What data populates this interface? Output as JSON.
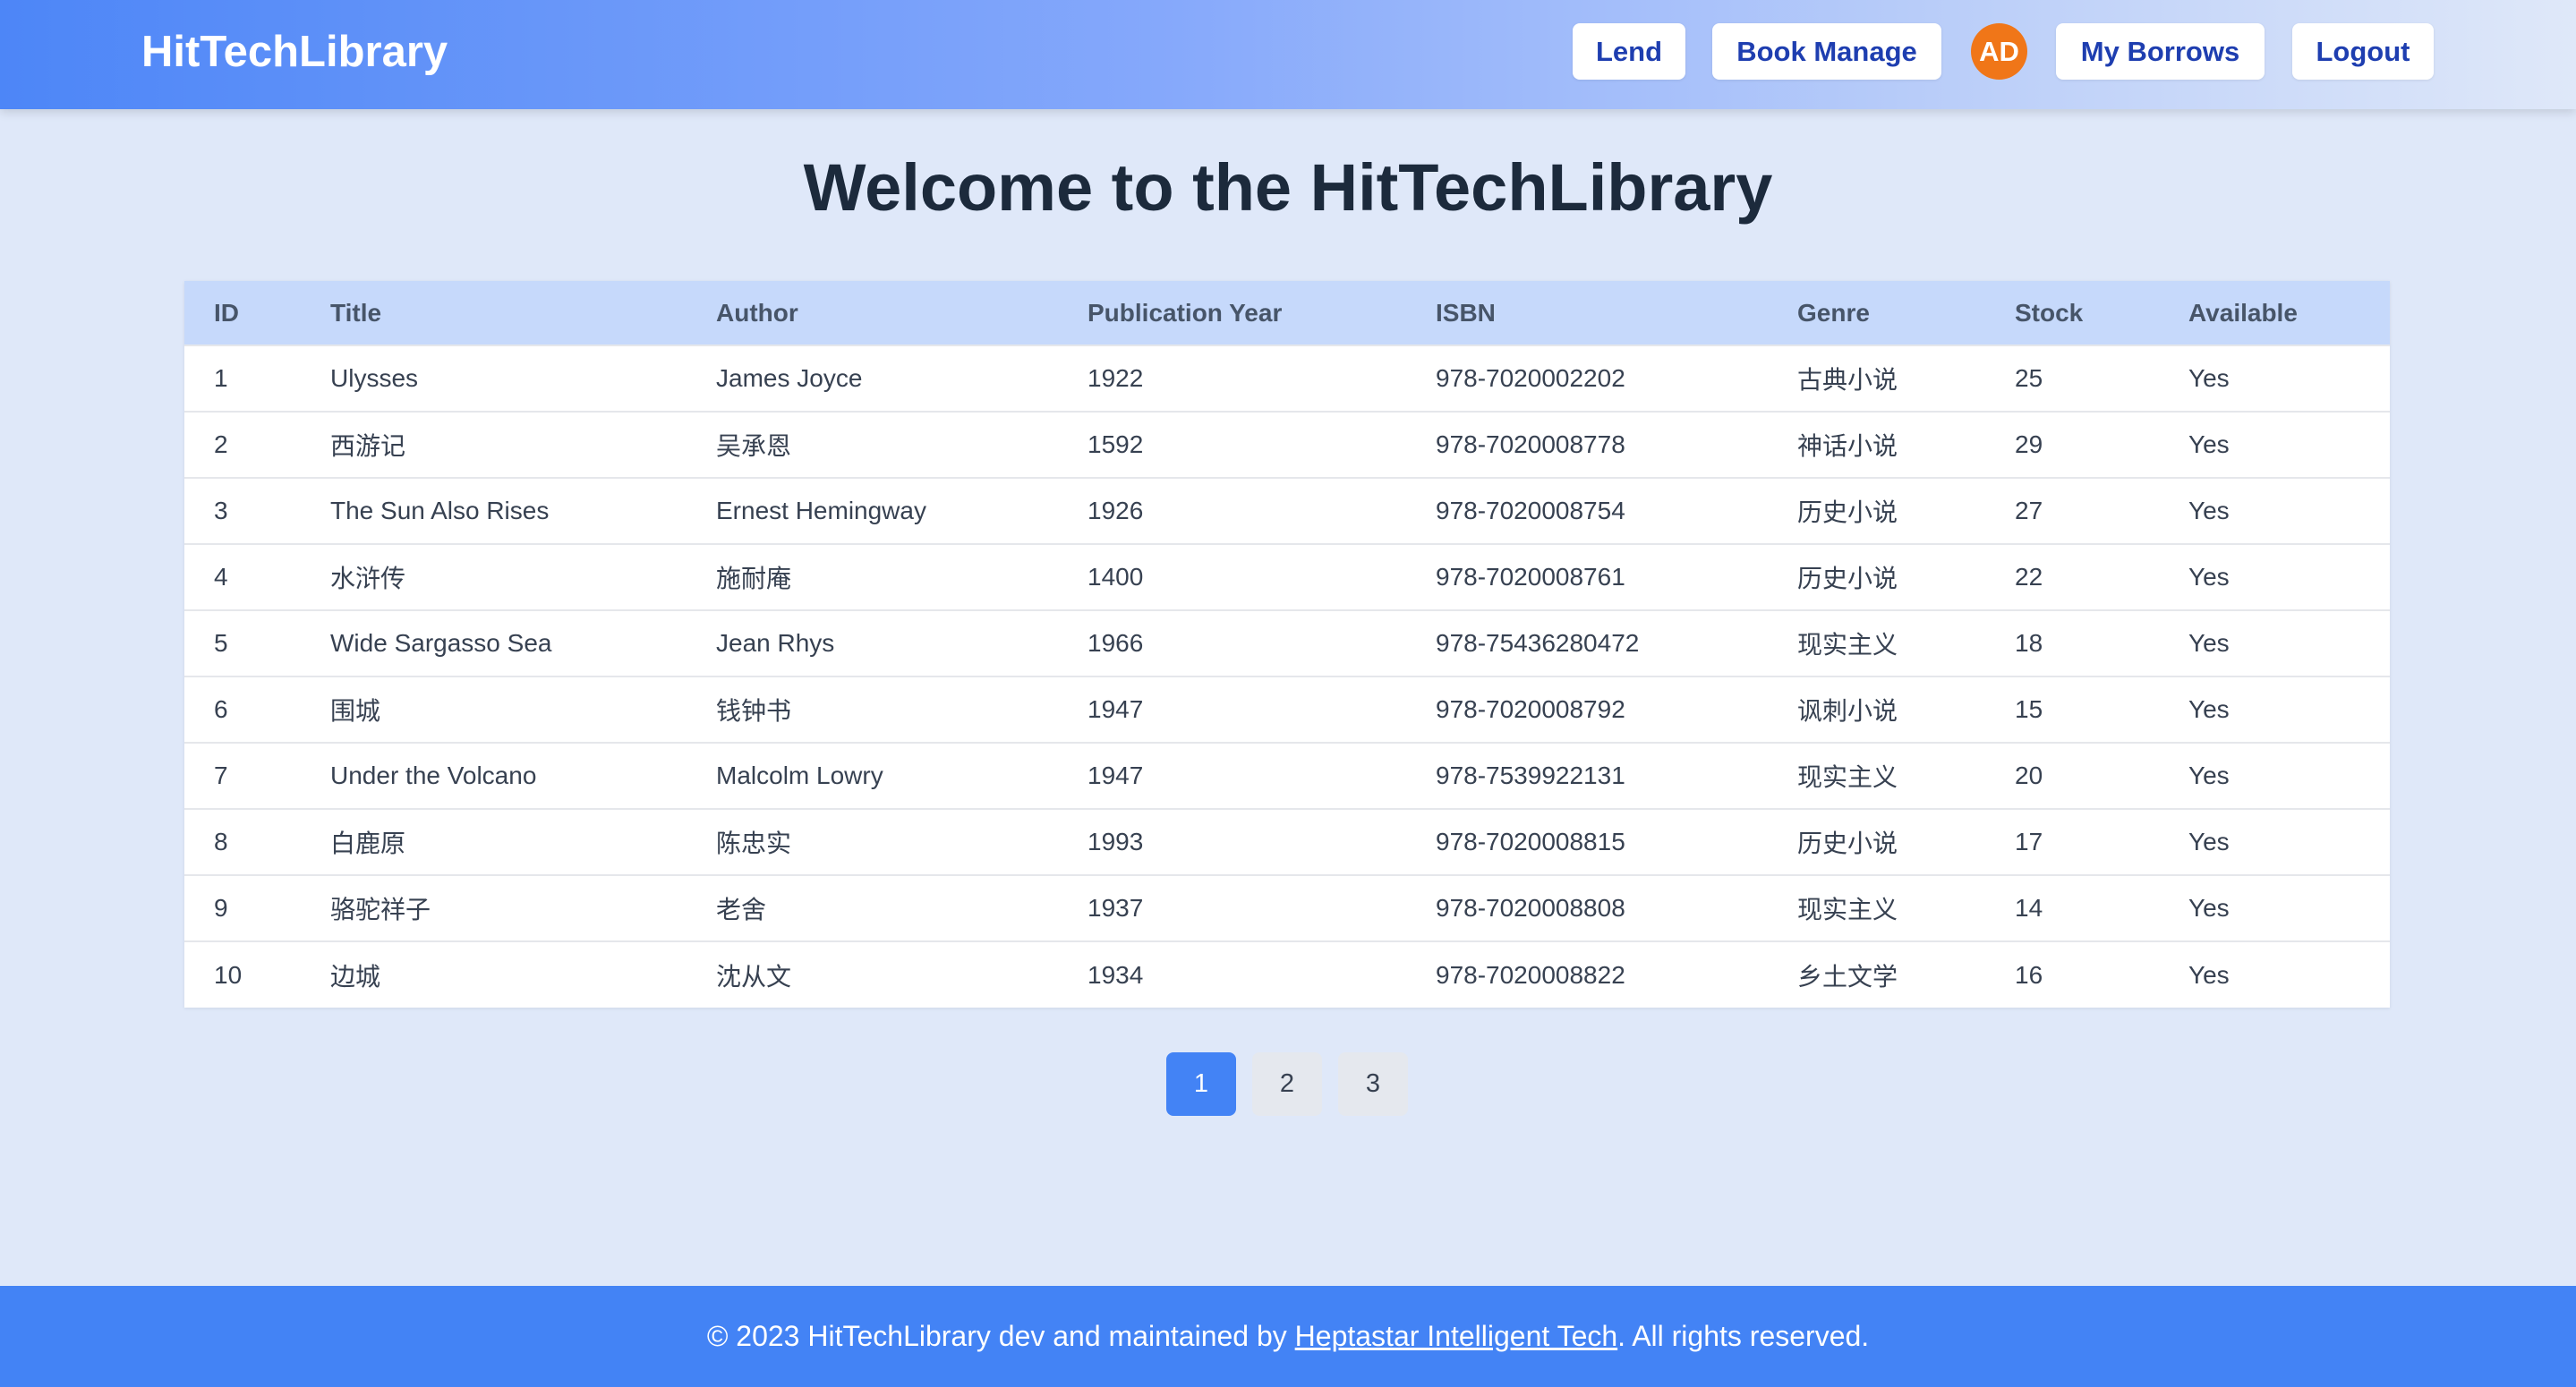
{
  "header": {
    "brand": "HitTechLibrary",
    "nav": {
      "lend": "Lend",
      "book_manage": "Book Manage",
      "avatar_initials": "AD",
      "my_borrows": "My Borrows",
      "logout": "Logout"
    }
  },
  "main": {
    "title": "Welcome to the HitTechLibrary",
    "table": {
      "columns": [
        "ID",
        "Title",
        "Author",
        "Publication Year",
        "ISBN",
        "Genre",
        "Stock",
        "Available"
      ],
      "rows": [
        [
          "1",
          "Ulysses",
          "James Joyce",
          "1922",
          "978-7020002202",
          "古典小说",
          "25",
          "Yes"
        ],
        [
          "2",
          "西游记",
          "吴承恩",
          "1592",
          "978-7020008778",
          "神话小说",
          "29",
          "Yes"
        ],
        [
          "3",
          "The Sun Also Rises",
          "Ernest Hemingway",
          "1926",
          "978-7020008754",
          "历史小说",
          "27",
          "Yes"
        ],
        [
          "4",
          "水浒传",
          "施耐庵",
          "1400",
          "978-7020008761",
          "历史小说",
          "22",
          "Yes"
        ],
        [
          "5",
          "Wide Sargasso Sea",
          "Jean Rhys",
          "1966",
          "978-75436280472",
          "现实主义",
          "18",
          "Yes"
        ],
        [
          "6",
          "围城",
          "钱钟书",
          "1947",
          "978-7020008792",
          "讽刺小说",
          "15",
          "Yes"
        ],
        [
          "7",
          "Under the Volcano",
          "Malcolm Lowry",
          "1947",
          "978-7539922131",
          "现实主义",
          "20",
          "Yes"
        ],
        [
          "8",
          "白鹿原",
          "陈忠实",
          "1993",
          "978-7020008815",
          "历史小说",
          "17",
          "Yes"
        ],
        [
          "9",
          "骆驼祥子",
          "老舍",
          "1937",
          "978-7020008808",
          "现实主义",
          "14",
          "Yes"
        ],
        [
          "10",
          "边城",
          "沈从文",
          "1934",
          "978-7020008822",
          "乡土文学",
          "16",
          "Yes"
        ]
      ]
    },
    "pagination": {
      "pages": [
        "1",
        "2",
        "3"
      ],
      "current": "1"
    }
  },
  "footer": {
    "prefix": "© 2023 HitTechLibrary dev and maintained by ",
    "link": "Heptastar Intelligent Tech",
    "suffix": ". All rights reserved."
  },
  "colors": {
    "accent": "#4383f5",
    "avatar": "#f07618",
    "nav_text": "#1e3eb0",
    "page_bg": "#dfe8f9",
    "table_header_bg": "#c6d9fb"
  }
}
